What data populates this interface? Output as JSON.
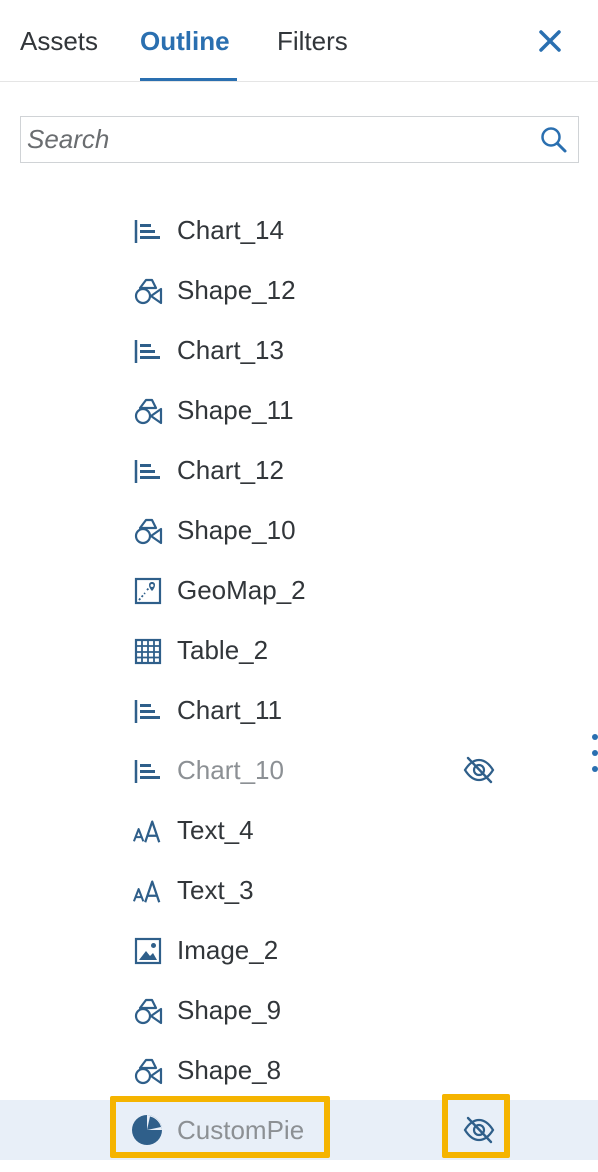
{
  "tabs": [
    {
      "label": "Assets",
      "active": false
    },
    {
      "label": "Outline",
      "active": true
    },
    {
      "label": "Filters",
      "active": false
    }
  ],
  "search": {
    "placeholder": "Search",
    "value": ""
  },
  "colors": {
    "accent": "#2a6fb0",
    "icon": "#2f5f8a",
    "highlight": "#f5b400",
    "selected_row": "#e8eff8",
    "hidden_text": "#8c9094"
  },
  "outline_items": [
    {
      "label": "Chart_14",
      "icon": "chart-bar-icon",
      "hidden": false
    },
    {
      "label": "Shape_12",
      "icon": "shape-icon",
      "hidden": false
    },
    {
      "label": "Chart_13",
      "icon": "chart-bar-icon",
      "hidden": false
    },
    {
      "label": "Shape_11",
      "icon": "shape-icon",
      "hidden": false
    },
    {
      "label": "Chart_12",
      "icon": "chart-bar-icon",
      "hidden": false
    },
    {
      "label": "Shape_10",
      "icon": "shape-icon",
      "hidden": false
    },
    {
      "label": "GeoMap_2",
      "icon": "geomap-icon",
      "hidden": false
    },
    {
      "label": "Table_2",
      "icon": "table-icon",
      "hidden": false
    },
    {
      "label": "Chart_11",
      "icon": "chart-bar-icon",
      "hidden": false
    },
    {
      "label": "Chart_10",
      "icon": "chart-bar-icon",
      "hidden": true
    },
    {
      "label": "Text_4",
      "icon": "text-icon",
      "hidden": false
    },
    {
      "label": "Text_3",
      "icon": "text-icon",
      "hidden": false
    },
    {
      "label": "Image_2",
      "icon": "image-icon",
      "hidden": false
    },
    {
      "label": "Shape_9",
      "icon": "shape-icon",
      "hidden": false
    },
    {
      "label": "Shape_8",
      "icon": "shape-icon",
      "hidden": false
    },
    {
      "label": "CustomPie",
      "icon": "pie-chart-icon",
      "hidden": true,
      "selected": true
    }
  ]
}
